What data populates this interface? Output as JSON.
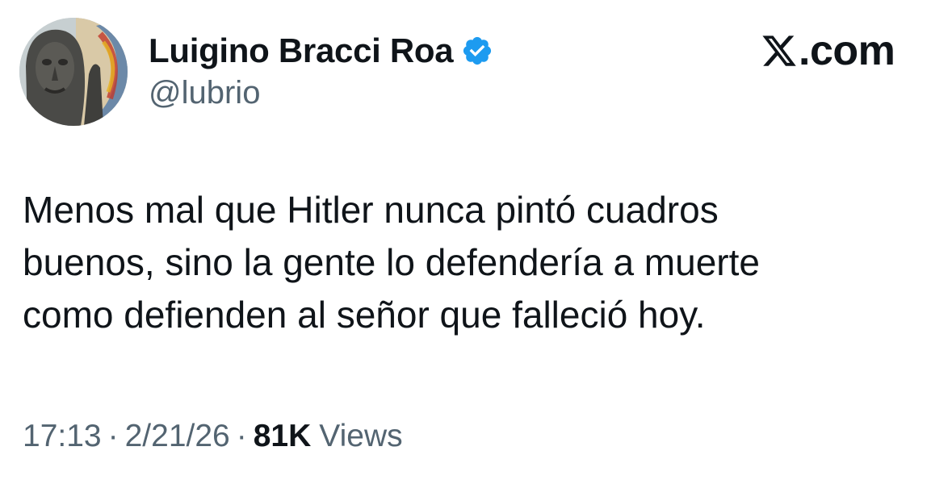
{
  "author": {
    "display_name": "Luigino Bracci Roa",
    "handle": "@lubrio",
    "verified_icon": "verified-badge-icon",
    "avatar_icon": "profile-avatar"
  },
  "brand": {
    "icon": "x-logo-icon",
    "text": ".com"
  },
  "tweet": {
    "lines": [
      "Menos mal que Hitler nunca pintó cuadros",
      "buenos, sino la gente lo defendería a muerte",
      "como defienden al señor que falleció hoy."
    ]
  },
  "meta": {
    "time": "17:13",
    "separator": "·",
    "date": "2/21/26",
    "views_count": "81K",
    "views_label": "Views"
  },
  "colors": {
    "text_primary": "#0f1419",
    "text_secondary": "#536471",
    "verified_blue": "#1d9bf0",
    "background": "#ffffff"
  }
}
